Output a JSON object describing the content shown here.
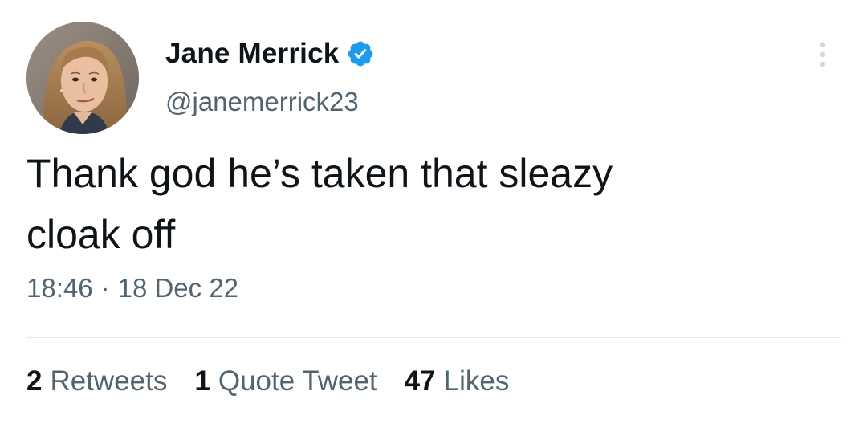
{
  "author": {
    "display_name": "Jane Merrick",
    "handle": "@janemerrick23",
    "verified_icon": "verified-badge-icon",
    "avatar_icon": "profile-photo"
  },
  "tweet": {
    "text": "Thank god he’s taken that sleazy\ncloak off",
    "time": "18:46",
    "separator": "·",
    "date": "18 Dec 22"
  },
  "stats": {
    "retweets_count": "2",
    "retweets_label": "Retweets",
    "quotes_count": "1",
    "quotes_label": "Quote Tweet",
    "likes_count": "47",
    "likes_label": "Likes"
  },
  "menu": {
    "icon": "more-vertical-icon"
  },
  "colors": {
    "text_primary": "#0f1419",
    "text_secondary": "#536471",
    "verified_blue": "#1d9bf0",
    "divider": "#e1e8ed"
  }
}
